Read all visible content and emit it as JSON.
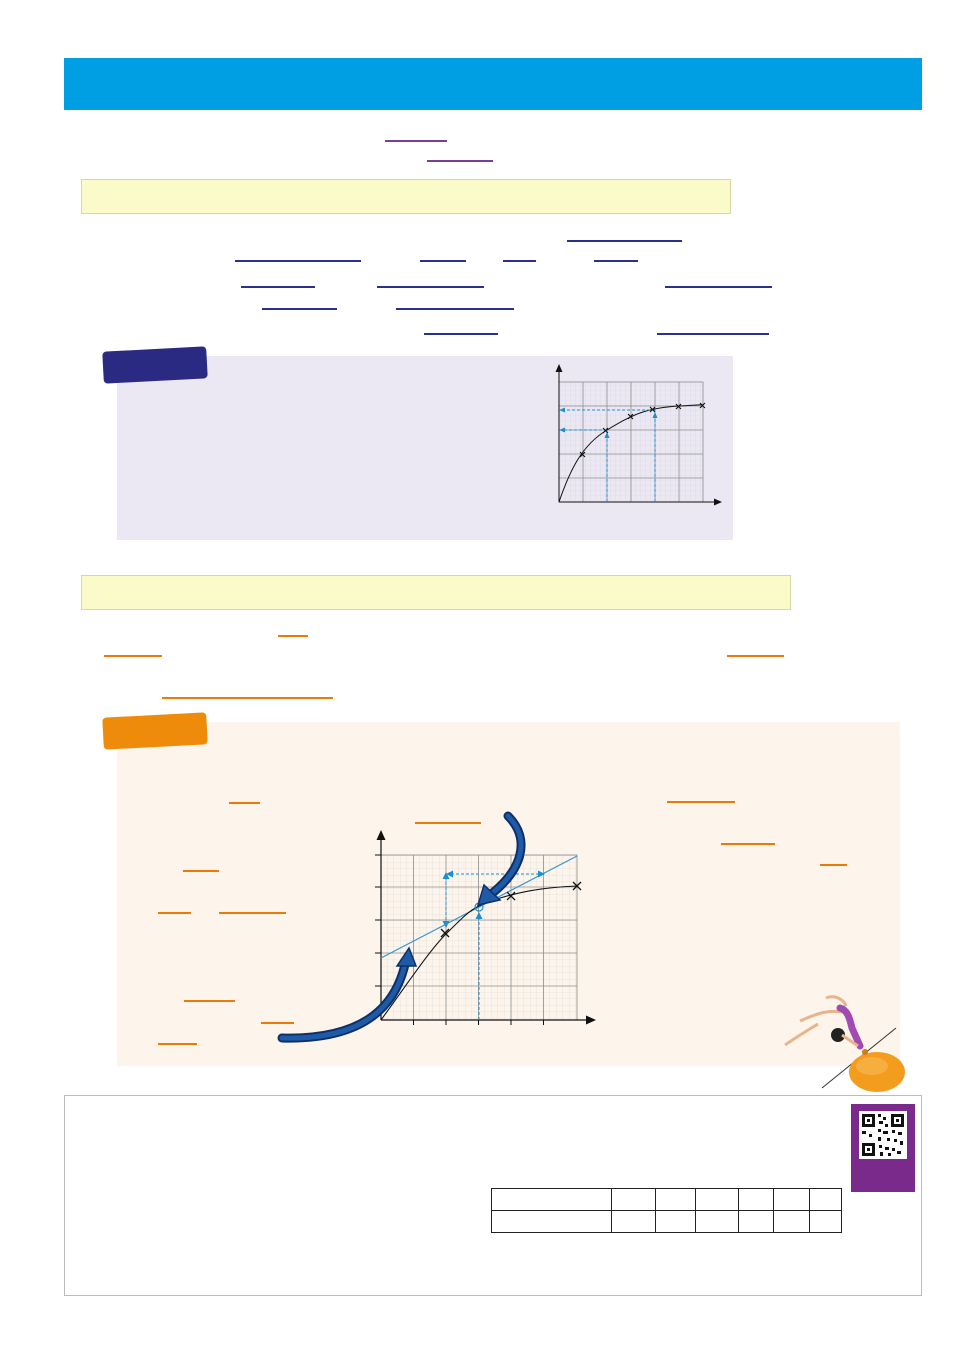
{
  "colors": {
    "banner": "#009fe3",
    "key_box": "#fbfbc9",
    "example1_panel": "#ebe8f4",
    "example1_tab": "#2a2a82",
    "example2_panel": "#fdf5ec",
    "example2_tab": "#ef8b0b",
    "qr_frame": "#7a2a8a",
    "curve_arrow": "#123f86",
    "guide_lines": "#1b8fd0",
    "tangent": "#3b93d0"
  },
  "icons": {
    "qr": "qr-code-icon",
    "gymnast": "gymnast-illustration",
    "ball": "orange-ball-illustration"
  },
  "footer_table": {
    "rows": 2,
    "cols": 7
  }
}
